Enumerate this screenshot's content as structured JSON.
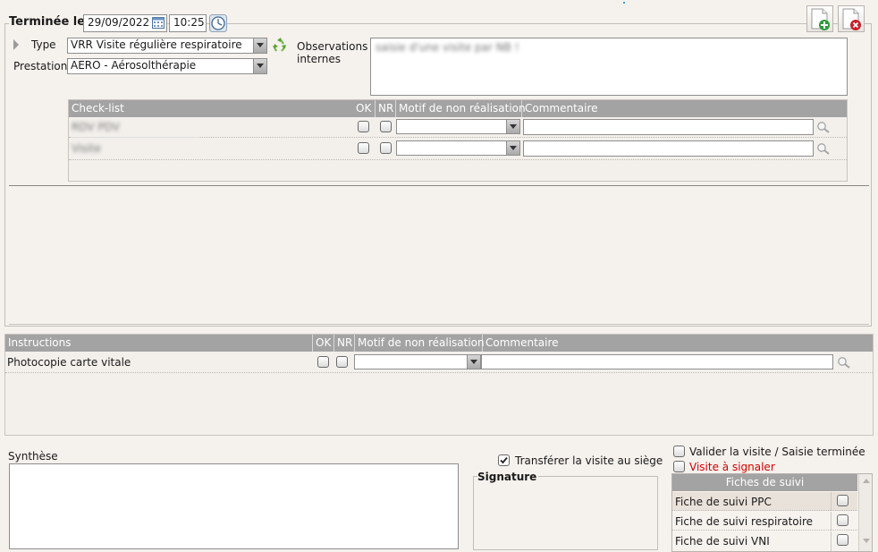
{
  "header": {
    "status_label": "Terminée le",
    "date_value": "29/09/2022",
    "time_value": "10:25"
  },
  "visit": {
    "type_label": "Type",
    "type_value": "VRR Visite régulière respiratoire",
    "prestation_label": "Prestation",
    "prestation_value": "AERO - Aérosolthérapie",
    "observations_label_1": "Observations",
    "observations_label_2": "internes",
    "observations_value": "saisie d'une visite par NB !"
  },
  "checklist": {
    "columns": [
      "Check-list",
      "OK",
      "NR",
      "Motif de non réalisation",
      "Commentaire"
    ],
    "rows": [
      {
        "label": "RDV PDV"
      },
      {
        "label": "Visite"
      }
    ]
  },
  "instructions": {
    "columns": [
      "Instructions",
      "OK",
      "NR",
      "Motif de non réalisation",
      "Commentaire"
    ],
    "rows": [
      {
        "label": "Photocopie carte vitale"
      }
    ]
  },
  "synthese": {
    "label": "Synthèse",
    "value": ""
  },
  "transfer": {
    "label": "Transférer la visite au siège",
    "checked": true
  },
  "signature": {
    "label": "Signature"
  },
  "validation": {
    "valider_label": "Valider la visite / Saisie terminée",
    "signaler_label": "Visite à signaler",
    "signaler_color": "#d40000"
  },
  "fiches": {
    "header": "Fiches de suivi",
    "items": [
      {
        "label": "Fiche de suivi PPC"
      },
      {
        "label": "Fiche de suivi respiratoire"
      },
      {
        "label": "Fiche de suivi VNI"
      }
    ]
  },
  "icons": {
    "calendar": "calendar-icon",
    "clock": "clock-icon",
    "recycle": "recycle-icon",
    "add_document": "add-document-icon",
    "delete_document": "delete-document-icon",
    "search": "magnifier-icon"
  }
}
